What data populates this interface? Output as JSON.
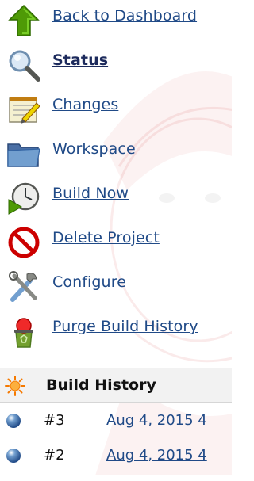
{
  "side_panel": {
    "tasks": [
      {
        "label": "Back to Dashboard",
        "icon": "up-arrow-icon",
        "bold": false
      },
      {
        "label": "Status",
        "icon": "magnifier-icon",
        "bold": true
      },
      {
        "label": "Changes",
        "icon": "notepad-icon",
        "bold": false
      },
      {
        "label": "Workspace",
        "icon": "folder-icon",
        "bold": false
      },
      {
        "label": "Build Now",
        "icon": "clock-play-icon",
        "bold": false
      },
      {
        "label": "Delete Project",
        "icon": "no-entry-icon",
        "bold": false
      },
      {
        "label": "Configure",
        "icon": "tools-icon",
        "bold": false
      },
      {
        "label": "Purge Build History",
        "icon": "recycle-bin-icon",
        "bold": false
      }
    ]
  },
  "build_history": {
    "title": "Build History",
    "builds": [
      {
        "number": "#3",
        "date": "Aug 4, 2015 4",
        "status_color": "#3465a4"
      },
      {
        "number": "#2",
        "date": "Aug 4, 2015 4",
        "status_color": "#3465a4"
      }
    ]
  },
  "colors": {
    "link": "#204a87",
    "header_bg": "#f2f2f2",
    "build_ball_blue": "#3465a4"
  }
}
